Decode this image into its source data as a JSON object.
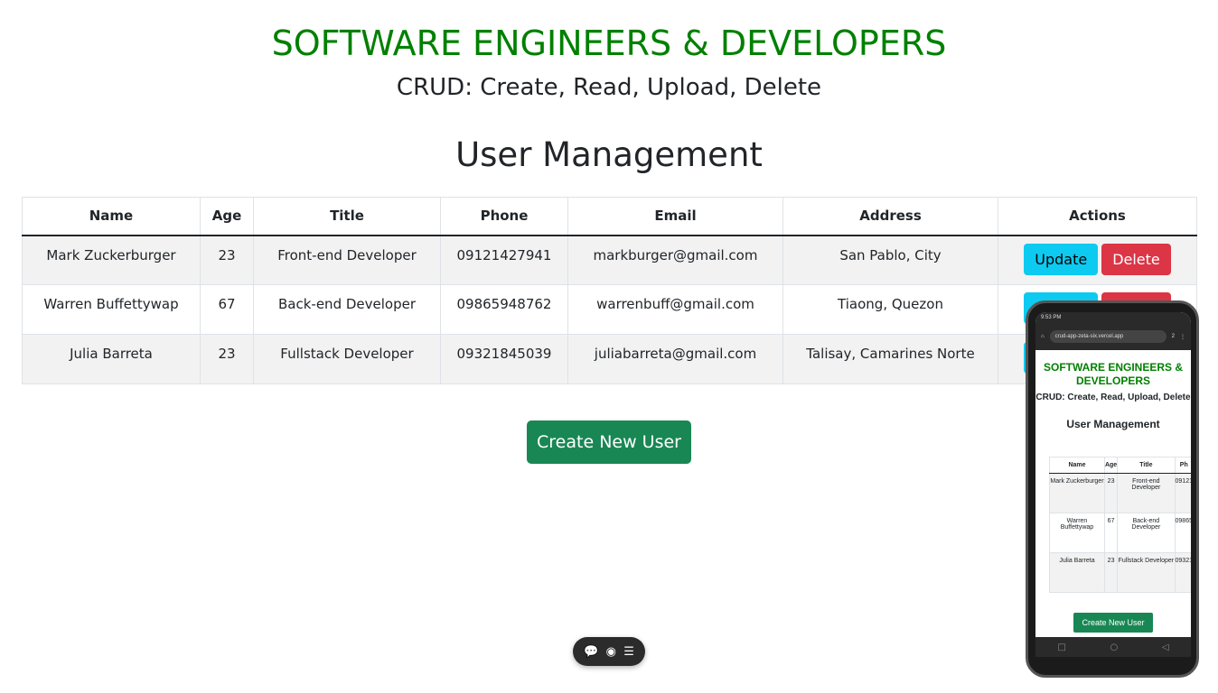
{
  "header": {
    "title": "SOFTWARE ENGINEERS & DEVELOPERS",
    "subtitle": "CRUD: Create, Read, Upload, Delete",
    "section": "User Management"
  },
  "table": {
    "columns": [
      "Name",
      "Age",
      "Title",
      "Phone",
      "Email",
      "Address",
      "Actions"
    ],
    "rows": [
      {
        "name": "Mark Zuckerburger",
        "age": "23",
        "title": "Front-end Developer",
        "phone": "09121427941",
        "email": "markburger@gmail.com",
        "address": "San Pablo, City"
      },
      {
        "name": "Warren Buffettywap",
        "age": "67",
        "title": "Back-end Developer",
        "phone": "09865948762",
        "email": "warrenbuff@gmail.com",
        "address": "Tiaong, Quezon"
      },
      {
        "name": "Julia Barreta",
        "age": "23",
        "title": "Fullstack Developer",
        "phone": "09321845039",
        "email": "juliabarreta@gmail.com",
        "address": "Talisay, Camarines Norte"
      }
    ],
    "update_label": "Update",
    "delete_label": "Delete"
  },
  "create_label": "Create New User",
  "phone": {
    "time": "9:53 PM",
    "url": "crud-app-zeta-six.vercel.app",
    "tabs": "2",
    "title": "SOFTWARE ENGINEERS & DEVELOPERS",
    "subtitle": "CRUD: Create, Read, Upload, Delete",
    "section": "User Management",
    "columns": [
      "Name",
      "Age",
      "Title",
      "Ph"
    ],
    "rows": [
      [
        "Mark Zuckerburger",
        "23",
        "Front-end Developer",
        "09121"
      ],
      [
        "Warren Buffettywap",
        "67",
        "Back-end Developer",
        "09865"
      ],
      [
        "Julia Barreta",
        "23",
        "Fullstack Developer",
        "09321"
      ]
    ],
    "create_label": "Create New User"
  },
  "colors": {
    "green": "#008000",
    "create": "#198754",
    "update": "#0dcaf0",
    "delete": "#dc3545"
  }
}
